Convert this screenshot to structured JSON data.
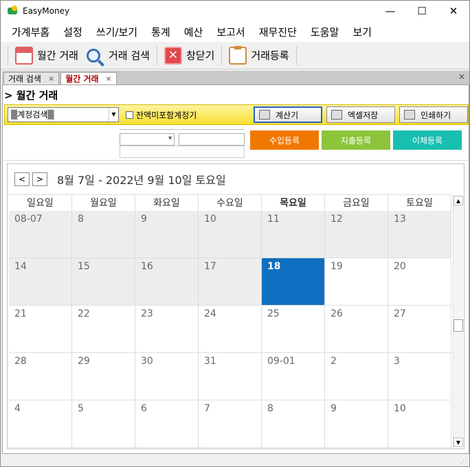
{
  "window": {
    "title": "EasyMoney",
    "min": "—",
    "max": "☐",
    "close": "✕"
  },
  "menu": [
    "가계부홈",
    "설정",
    "쓰기/보기",
    "통계",
    "예산",
    "보고서",
    "재무진단",
    "도움말",
    "보기"
  ],
  "toolbar": [
    {
      "label": "월간 거래",
      "icon": "calendar-icon"
    },
    {
      "label": "거래 검색",
      "icon": "search-icon"
    },
    {
      "label": "창닫기",
      "icon": "close-window-icon"
    },
    {
      "label": "거래등록",
      "icon": "clipboard-icon"
    }
  ],
  "tabs": [
    {
      "label": "거래 검색",
      "close": "×"
    },
    {
      "label": "월간 거래",
      "close": "×"
    }
  ],
  "panel_close": "✕",
  "heading": "> 월간 거래",
  "filter": {
    "combo": "▒계정검색▒",
    "checkbox_label": "잔액미포함계정기",
    "calc": "계산기",
    "excel": "엑셀저장",
    "print": "인쇄하기"
  },
  "actions": {
    "income": "수입등록",
    "expense": "지출등록",
    "transfer": "이체등록"
  },
  "calendar": {
    "range": "8월 7일 - 2022년 9월 10일 토요일",
    "prev": "<",
    "next": ">",
    "weekdays": [
      "일요일",
      "월요일",
      "화요일",
      "수요일",
      "목요일",
      "금요일",
      "토요일"
    ],
    "weeks": [
      [
        "08-07",
        "8",
        "9",
        "10",
        "11",
        "12",
        "13"
      ],
      [
        "14",
        "15",
        "16",
        "17",
        "18",
        "19",
        "20"
      ],
      [
        "21",
        "22",
        "23",
        "24",
        "25",
        "26",
        "27"
      ],
      [
        "28",
        "29",
        "30",
        "31",
        "09-01",
        "2",
        "3"
      ],
      [
        "4",
        "5",
        "6",
        "7",
        "8",
        "9",
        "10"
      ]
    ],
    "today": "18"
  },
  "colors": {
    "today": "#0f6fc0",
    "income": "#f07800",
    "expense": "#8cc43c",
    "transfer": "#17bfb0"
  }
}
